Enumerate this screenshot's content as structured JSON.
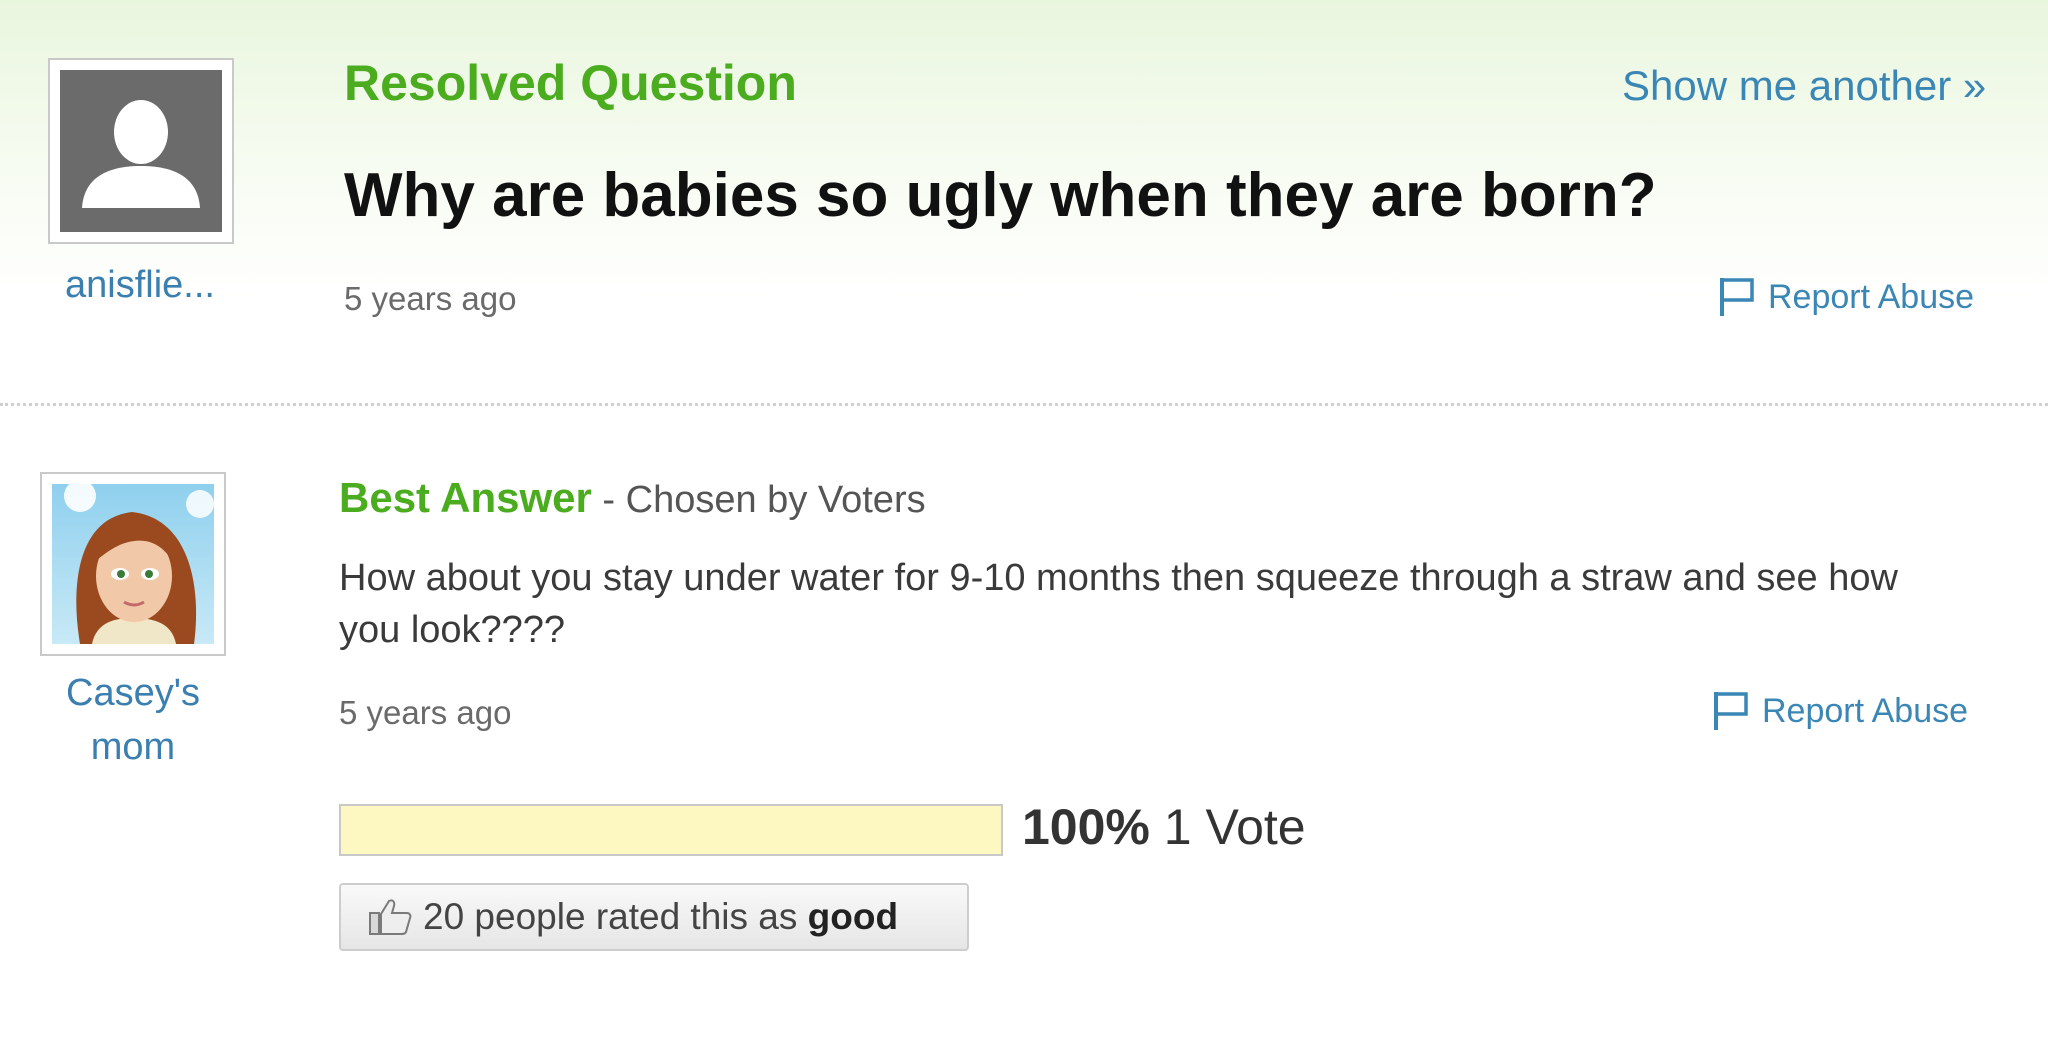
{
  "question": {
    "status_label": "Resolved Question",
    "show_another": "Show me another »",
    "title": "Why are babies so ugly when they are born?",
    "time": "5 years ago",
    "report": "Report Abuse",
    "asker": {
      "name": "anisflie..."
    }
  },
  "answer": {
    "label": "Best Answer",
    "chosen_by": " - Chosen by Voters",
    "text": "How about you stay under water for 9-10 months then squeeze through a straw and see how you look????",
    "time": "5 years ago",
    "report": "Report Abuse",
    "answerer": {
      "name": "Casey's mom"
    },
    "vote": {
      "percent_text": "100%",
      "votes_text": " 1 Vote",
      "fill_fraction": 1.0
    },
    "rating": {
      "prefix": "20 people rated this as ",
      "emphasis": "good"
    }
  },
  "colors": {
    "green_heading": "#4cac1f",
    "link_blue": "#3a86b5",
    "vote_fill": "#fdf8c2"
  },
  "icons": [
    "user-silhouette-icon",
    "flag-icon",
    "thumbs-up-icon"
  ]
}
